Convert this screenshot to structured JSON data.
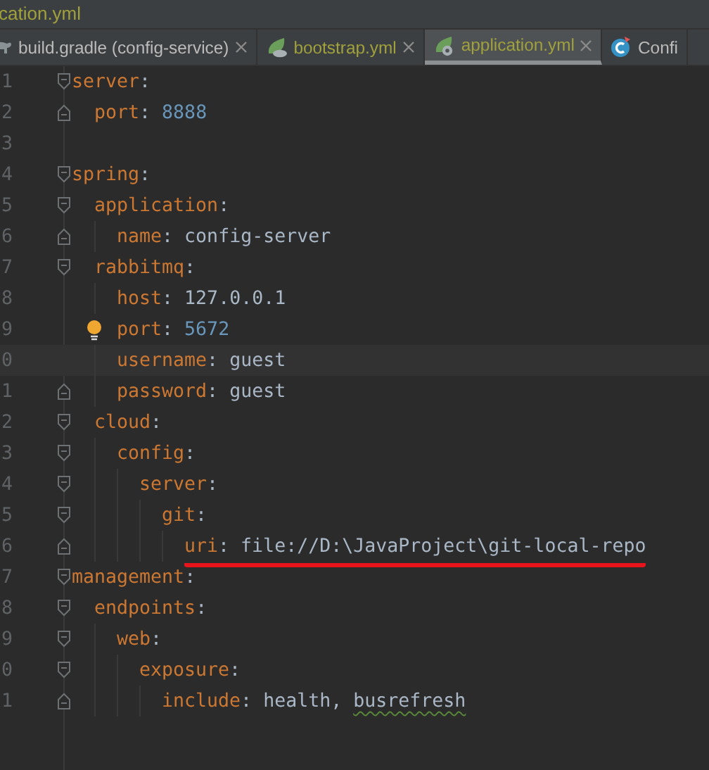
{
  "window": {
    "title": "cation.yml"
  },
  "tabs": [
    {
      "label": "build.gradle (config-service)",
      "color": "#bbbbbb",
      "selected": false,
      "closable": true
    },
    {
      "label": "bootstrap.yml",
      "color": "#a0a03c",
      "selected": false,
      "closable": true
    },
    {
      "label": "application.yml",
      "color": "#a0a03c",
      "selected": true,
      "closable": true
    },
    {
      "label": "Confi",
      "color": "#bbbbbb",
      "selected": false,
      "closable": false
    }
  ],
  "editor": {
    "lines": [
      {
        "line_number": "1",
        "key": "server:",
        "children": [
          {
            "line_number": "2",
            "key": "port:",
            "value": "8888",
            "kind": "number"
          }
        ]
      },
      {
        "line_number": "3"
      },
      {
        "line_number": "4",
        "key": "spring:",
        "children": [
          {
            "line_number": "5",
            "key": "application:",
            "children": [
              {
                "line_number": "6",
                "key": "name:",
                "value": "config-server",
                "kind": "string"
              }
            ]
          },
          {
            "line_number": "7",
            "key": "rabbitmq:",
            "children": [
              {
                "line_number": "8",
                "key": "host:",
                "value": "127.0.0.1",
                "kind": "string"
              },
              {
                "line_number": "9",
                "key": "port:",
                "value": "5672",
                "kind": "number",
                "bulb": true
              },
              {
                "line_number": "0",
                "key": "username:",
                "value": "guest",
                "kind": "string",
                "current": true
              },
              {
                "line_number": "1",
                "key": "password:",
                "value": "guest",
                "kind": "string"
              }
            ]
          },
          {
            "line_number": "2",
            "key": "cloud:",
            "children": [
              {
                "line_number": "3",
                "key": "config:",
                "children": [
                  {
                    "line_number": "4",
                    "key": "server:",
                    "children": [
                      {
                        "line_number": "5",
                        "key": "git:",
                        "children": [
                          {
                            "line_number": "6",
                            "key": "uri:",
                            "value": "file://D:\\JavaProject\\git-local-repo",
                            "kind": "string",
                            "underlined": true
                          }
                        ]
                      }
                    ]
                  }
                ]
              }
            ]
          }
        ]
      },
      {
        "line_number": "7",
        "key": "management:",
        "children": [
          {
            "line_number": "8",
            "key": "endpoints:",
            "children": [
              {
                "line_number": "9",
                "key": "web:",
                "children": [
                  {
                    "line_number": "0",
                    "key": "exposure:",
                    "children": [
                      {
                        "line_number": "1",
                        "key": "include:",
                        "values": [
                          {
                            "text": "health,",
                            "typo": false
                          },
                          {
                            "text": "busrefresh",
                            "typo": true
                          }
                        ],
                        "kind": "string"
                      }
                    ]
                  }
                ]
              }
            ]
          }
        ]
      }
    ]
  }
}
